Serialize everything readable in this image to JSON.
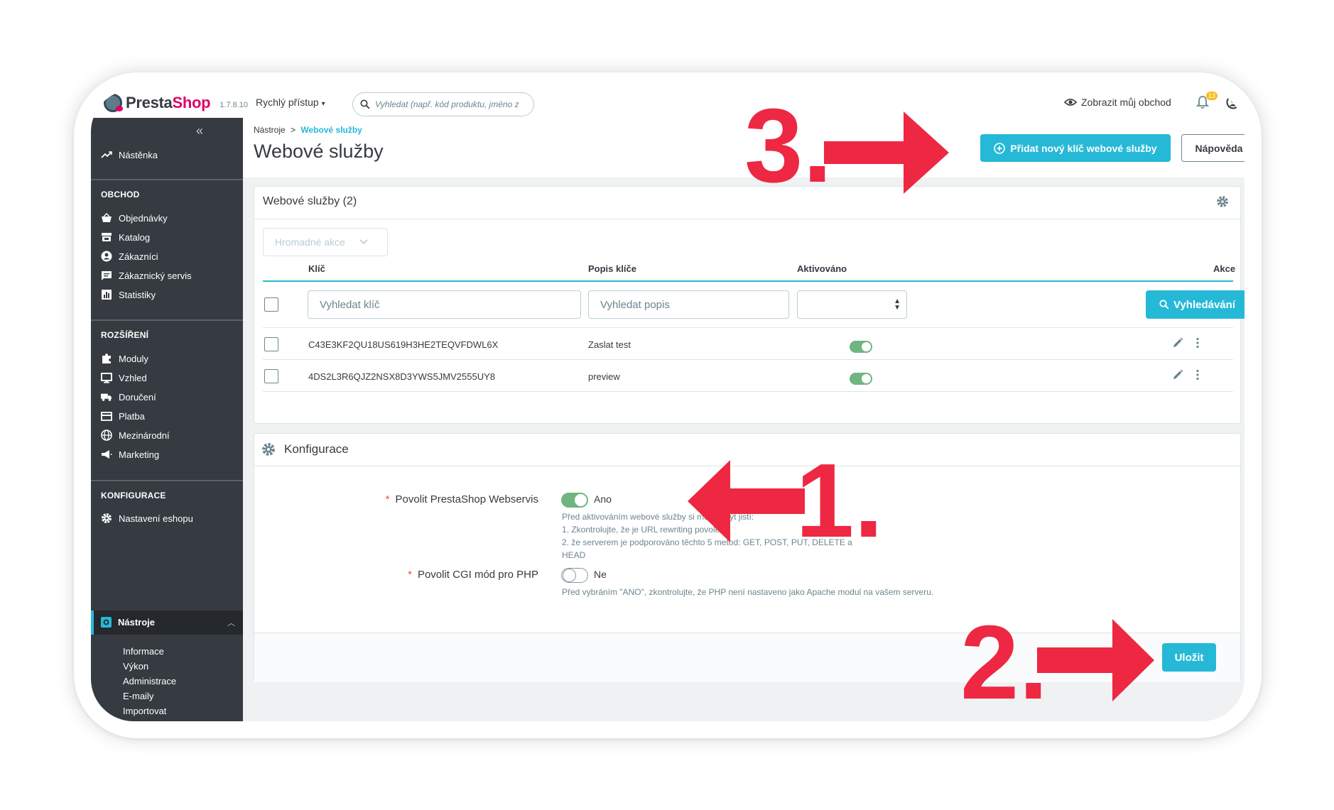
{
  "app": {
    "brand_prefix": "Presta",
    "brand_suffix": "Shop",
    "version": "1.7.8.10",
    "quick_access": "Rychlý přístup",
    "search_placeholder": "Vyhledat (např. kód produktu, jméno z",
    "view_shop": "Zobrazit můj obchod",
    "notification_count": "13"
  },
  "sidebar": {
    "collapse_label": "«",
    "dashboard": "Nástěnka",
    "sections": [
      {
        "title": "OBCHOD",
        "items": [
          "Objednávky",
          "Katalog",
          "Zákazníci",
          "Zákaznický servis",
          "Statistiky"
        ]
      },
      {
        "title": "ROZŠÍŘENÍ",
        "items": [
          "Moduly",
          "Vzhled",
          "Doručení",
          "Platba",
          "Mezinárodní",
          "Marketing"
        ]
      },
      {
        "title": "KONFIGURACE",
        "items": [
          "Nastavení eshopu",
          "Nástroje"
        ]
      }
    ],
    "active_item": "Nástroje",
    "subitems": [
      "Informace",
      "Výkon",
      "Administrace",
      "E-maily",
      "Importovat"
    ]
  },
  "breadcrumb": {
    "parent": "Nástroje",
    "separator": ">",
    "current": "Webové služby"
  },
  "page_title": "Webové služby",
  "toolbar": {
    "add_key": "Přidat nový klíč webové služby",
    "help": "Nápověda"
  },
  "list": {
    "title": "Webové služby (2)",
    "bulk_actions": "Hromadné akce",
    "columns": {
      "key": "Klíč",
      "description": "Popis klíče",
      "active": "Aktivováno",
      "actions": "Akce"
    },
    "filters": {
      "key_placeholder": "Vyhledat klíč",
      "description_placeholder": "Vyhledat popis",
      "search_button": "Vyhledávání"
    },
    "rows": [
      {
        "key": "C43E3KF2QU18US619H3HE2TEQVFDWL6X",
        "description": "Zaslat test",
        "active": true
      },
      {
        "key": "4DS2L3R6QJZ2NSX8D3YWS5JMV2555UY8",
        "description": "preview",
        "active": true
      }
    ]
  },
  "config": {
    "title": "Konfigurace",
    "fields": [
      {
        "label": "Povolit PrestaShop Webservis",
        "required": "*",
        "value": "Ano",
        "enabled": true,
        "help": [
          "Před aktivováním webové služby si musíte být jistí:",
          "1. Zkontrolujte, že je URL rewriting povolen.",
          "2. že serverem je podporováno těchto 5 metod: GET, POST, PUT, DELETE a HEAD"
        ]
      },
      {
        "label": "Povolit CGI mód pro PHP",
        "required": "*",
        "value": "Ne",
        "enabled": false,
        "help": [
          "Před vybráním \"ANO\", zkontrolujte, že PHP není nastaveno jako Apache modul na vašem serveru."
        ]
      }
    ],
    "save": "Uložit"
  },
  "annotations": {
    "step1": "1.",
    "step2": "2.",
    "step3": "3."
  },
  "colors": {
    "accent": "#25b9d7",
    "sidebar": "#363a41",
    "toggle_on": "#70b580",
    "annotation": "#ee2842",
    "brand": "#df0067"
  }
}
